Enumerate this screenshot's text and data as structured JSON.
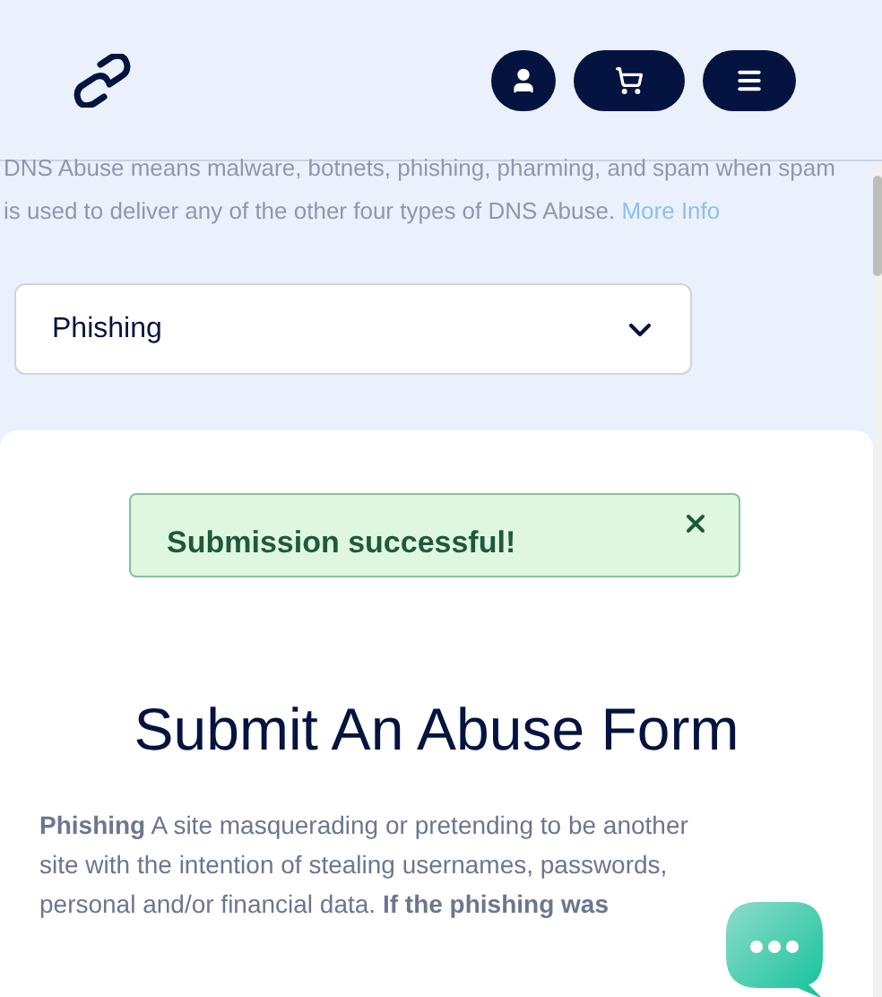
{
  "header": {
    "buttons": [
      {
        "kind": "account"
      },
      {
        "kind": "cart"
      },
      {
        "kind": "menu"
      }
    ]
  },
  "intro": {
    "text": "DNS Abuse means malware, botnets, phishing, pharming, and spam when spam is used to deliver any of the other four types of DNS Abuse.",
    "link": "More Info"
  },
  "abuse_type_select": {
    "value": "Phishing"
  },
  "alert": {
    "message": "Submission successful!"
  },
  "form": {
    "title": "Submit An Abuse Form",
    "description": "**Phishing** A site masquerading or pretending to be another site with the intention of stealing usernames, passwords, personal and/or financial data. **If the phishing was**"
  }
}
